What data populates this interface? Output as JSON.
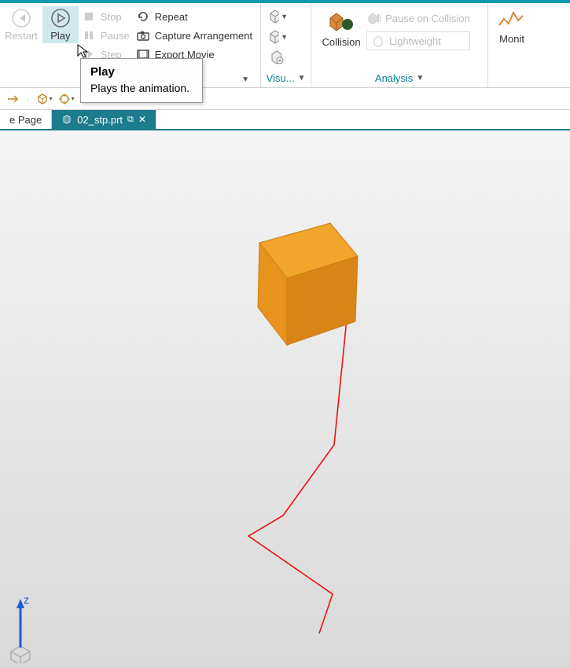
{
  "ribbon": {
    "playback": {
      "restart": "Restart",
      "play": "Play",
      "stop": "Stop",
      "pause": "Pause",
      "step": "Step",
      "repeat": "Repeat",
      "capture": "Capture Arrangement",
      "export": "Export Movie"
    },
    "visu_group": "Visu...",
    "collision": {
      "label": "Collision",
      "pause_on_collision": "Pause on Collision",
      "lightweight": "Lightweight"
    },
    "analysis_group": "Analysis",
    "monitor": "Monit"
  },
  "tooltip": {
    "title": "Play",
    "body": "Plays the animation."
  },
  "tabs": {
    "page": "e Page",
    "active_file": "02_stp.prt"
  },
  "gizmo_axis": "z"
}
